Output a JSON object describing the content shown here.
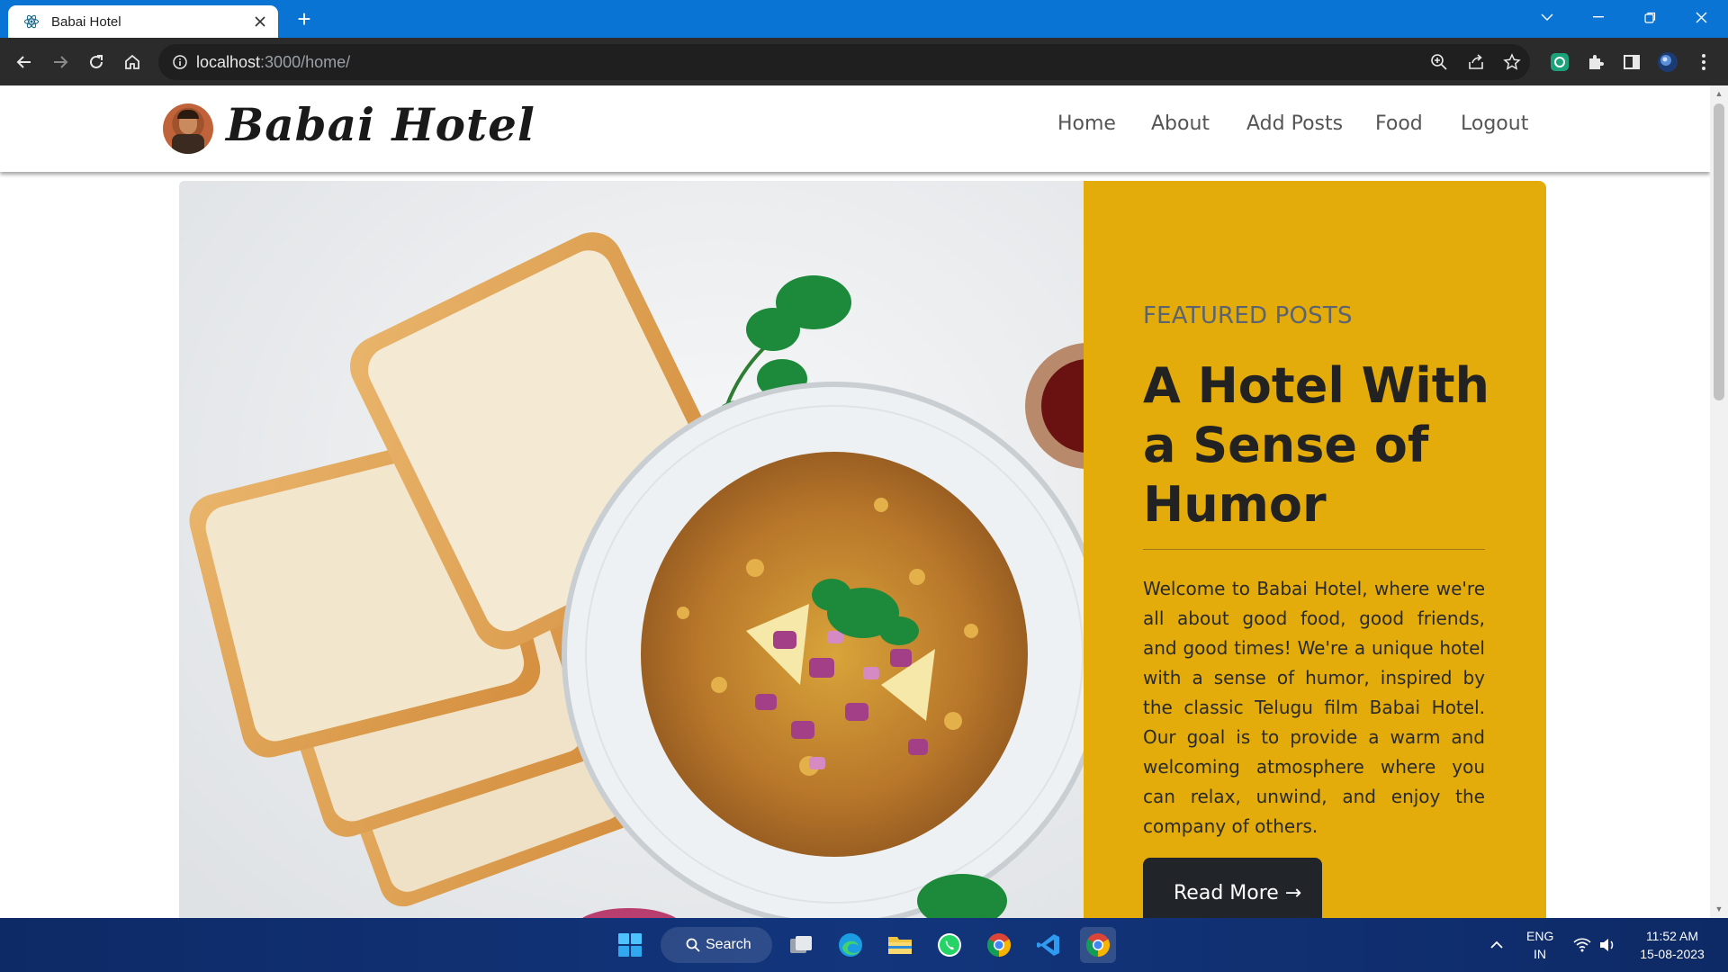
{
  "browser": {
    "tab_title": "Babai Hotel",
    "url_host": "localhost",
    "url_rest": ":3000/home/"
  },
  "site": {
    "brand": "Babai Hotel",
    "nav": [
      "Home",
      "About",
      "Add Posts",
      "Food",
      "Logout"
    ]
  },
  "feature": {
    "kicker": "FEATURED POSTS",
    "heading": "A Hotel With a Sense of Humor",
    "body": "Welcome to Babai Hotel, where we're all about good food, good friends, and good times! We're a unique hotel with a sense of humor, inspired by the classic Telugu film Babai Hotel. Our goal is to provide a warm and welcoming atmosphere where you can relax, unwind, and enjoy the company of others.",
    "button": "Read More →",
    "accent_color": "#e3ac0a"
  },
  "taskbar": {
    "search_label": "Search",
    "lang_1": "ENG",
    "lang_2": "IN",
    "time": "11:52 AM",
    "date": "15-08-2023"
  }
}
